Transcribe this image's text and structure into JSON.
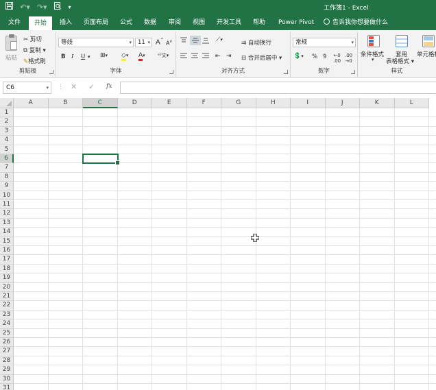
{
  "window": {
    "title": "工作簿1  -  Excel",
    "qat": [
      "save-icon",
      "undo-icon",
      "redo-icon",
      "print-preview-icon",
      "customize-icon"
    ]
  },
  "tabs": [
    {
      "label": "文件",
      "active": false
    },
    {
      "label": "开始",
      "active": true
    },
    {
      "label": "插入",
      "active": false
    },
    {
      "label": "页面布局",
      "active": false
    },
    {
      "label": "公式",
      "active": false
    },
    {
      "label": "数据",
      "active": false
    },
    {
      "label": "审阅",
      "active": false
    },
    {
      "label": "视图",
      "active": false
    },
    {
      "label": "开发工具",
      "active": false
    },
    {
      "label": "帮助",
      "active": false
    },
    {
      "label": "Power Pivot",
      "active": false
    }
  ],
  "tell_me": "告诉我你想要做什么",
  "ribbon": {
    "clipboard": {
      "label": "剪贴板",
      "paste": "粘贴",
      "cut": "剪切",
      "copy": "复制",
      "format_painter": "格式刷"
    },
    "font": {
      "label": "字体",
      "font_name": "等线",
      "font_size": "11",
      "bold": "B",
      "italic": "I",
      "underline": "U",
      "grow": "A",
      "shrink": "A"
    },
    "alignment": {
      "label": "对齐方式",
      "wrap_text": "自动换行",
      "merge_center": "合并后居中"
    },
    "number": {
      "label": "数字",
      "format": "常规",
      "percent": "%",
      "comma": "9"
    },
    "styles": {
      "label": "样式",
      "conditional": "条件格式",
      "table_line1": "套用",
      "table_line2": "表格格式",
      "cell_styles": "单元格样"
    }
  },
  "formula_bar": {
    "name_box": "C6",
    "fx": "fx",
    "cancel": "✕",
    "enter": "✓",
    "value": ""
  },
  "grid": {
    "columns": [
      "A",
      "B",
      "C",
      "D",
      "E",
      "F",
      "G",
      "H",
      "I",
      "J",
      "K",
      "L"
    ],
    "rows": [
      "1",
      "2",
      "3",
      "4",
      "5",
      "6",
      "7",
      "8",
      "9",
      "10",
      "11",
      "12",
      "13",
      "14",
      "15",
      "16",
      "17",
      "18",
      "19",
      "20",
      "21",
      "22",
      "23",
      "24",
      "25",
      "26",
      "27",
      "28",
      "29",
      "30",
      "31"
    ],
    "selected_col": "C",
    "selected_row": "6"
  },
  "colors": {
    "accent": "#217346",
    "ribbon_bg": "#f3f3f3",
    "header_bg": "#e9e9e9"
  }
}
